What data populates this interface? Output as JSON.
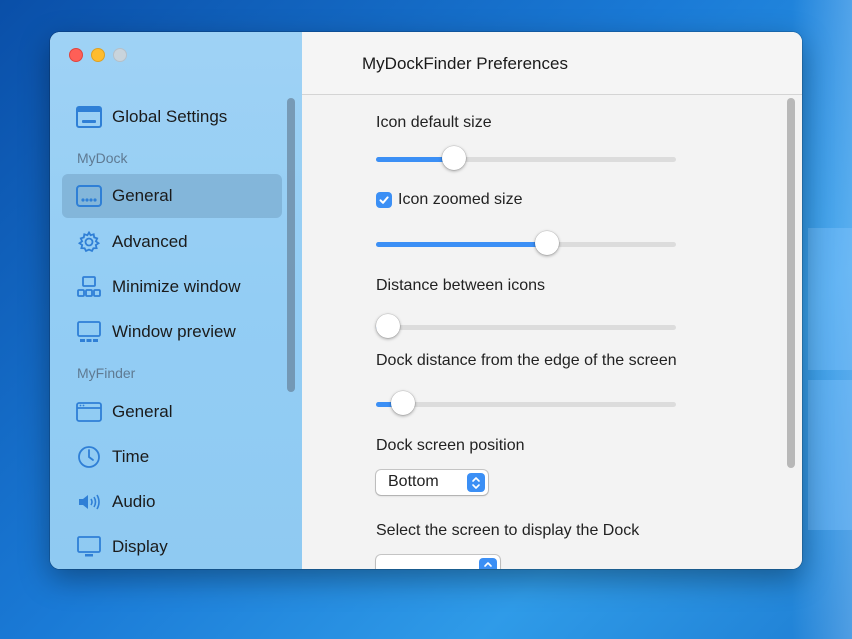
{
  "window": {
    "title": "MyDockFinder Preferences"
  },
  "sidebar": {
    "global": {
      "label": "Global Settings",
      "icon": "window-icon"
    },
    "sections": [
      {
        "label": "MyDock"
      },
      {
        "label": "MyFinder"
      }
    ],
    "mydock_items": [
      {
        "label": "General",
        "icon": "dock-icon",
        "active": true
      },
      {
        "label": "Advanced",
        "icon": "gear-icon",
        "active": false
      },
      {
        "label": "Minimize window",
        "icon": "minimize-window-icon",
        "active": false
      },
      {
        "label": "Window preview",
        "icon": "window-preview-icon",
        "active": false
      }
    ],
    "myfinder_items": [
      {
        "label": "General",
        "icon": "finder-window-icon"
      },
      {
        "label": "Time",
        "icon": "clock-icon"
      },
      {
        "label": "Audio",
        "icon": "speaker-icon"
      },
      {
        "label": "Display",
        "icon": "monitor-icon"
      }
    ]
  },
  "settings": {
    "icon_default_size": {
      "label": "Icon default size",
      "value_fraction": 0.26
    },
    "icon_zoomed_size": {
      "label": "Icon zoomed size",
      "checked": true,
      "value_fraction": 0.57
    },
    "distance_between_icons": {
      "label": "Distance between icons",
      "value_fraction": 0.04
    },
    "dock_distance_edge": {
      "label": "Dock distance from the edge of the screen",
      "value_fraction": 0.09
    },
    "dock_screen_position": {
      "label": "Dock screen position",
      "value": "Bottom"
    },
    "display_screen": {
      "label": "Select the screen to display the Dock",
      "value": ""
    }
  },
  "colors": {
    "accent": "#3b8ff5",
    "sidebar": "#9fd2f5",
    "close": "#fe5f57",
    "minimize": "#febc2e"
  }
}
